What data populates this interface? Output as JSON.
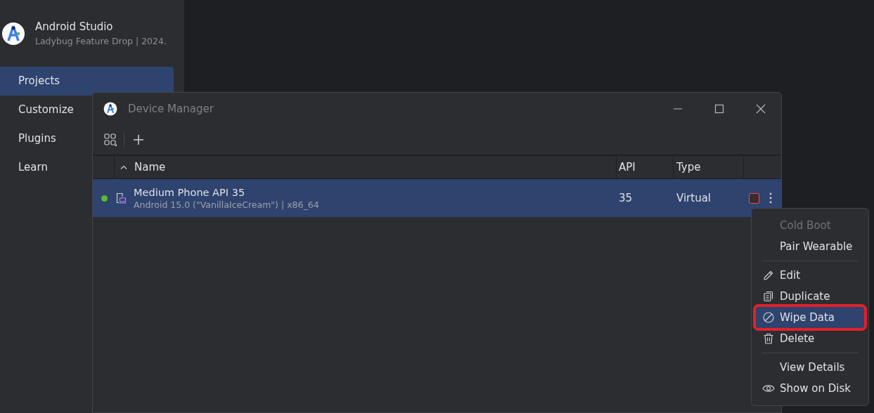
{
  "app": {
    "title": "Android Studio",
    "subtitle": "Ladybug Feature Drop | 2024."
  },
  "sidebar": {
    "items": [
      {
        "label": "Projects",
        "selected": true
      },
      {
        "label": "Customize",
        "selected": false
      },
      {
        "label": "Plugins",
        "selected": false
      },
      {
        "label": "Learn",
        "selected": false
      }
    ]
  },
  "dialog": {
    "title": "Device Manager",
    "table": {
      "columns": [
        {
          "label": "Name",
          "sorted": true
        },
        {
          "label": "API",
          "sorted": false
        },
        {
          "label": "Type",
          "sorted": false
        }
      ],
      "rows": [
        {
          "name": "Medium Phone API 35",
          "details": "Android 15.0 (\"VanillaIceCream\") | x86_64",
          "api": "35",
          "type": "Virtual",
          "selected": true,
          "color": "#5fb832",
          "running": true
        }
      ]
    }
  },
  "context_menu": {
    "items": [
      {
        "kind": "plain",
        "label": "Cold Boot",
        "disabled": true,
        "selected": false,
        "highlighted": false
      },
      {
        "kind": "plain",
        "label": "Pair Wearable",
        "disabled": false,
        "selected": false,
        "highlighted": false
      },
      {
        "kind": "separator"
      },
      {
        "kind": "pencil",
        "label": "Edit",
        "disabled": false,
        "selected": false,
        "highlighted": false
      },
      {
        "kind": "copy",
        "label": "Duplicate",
        "disabled": false,
        "selected": false,
        "highlighted": false
      },
      {
        "kind": "blocked",
        "label": "Wipe Data",
        "disabled": false,
        "selected": true,
        "highlighted": true
      },
      {
        "kind": "trash",
        "label": "Delete",
        "disabled": false,
        "selected": false,
        "highlighted": false
      },
      {
        "kind": "separator"
      },
      {
        "kind": "plain",
        "label": "View Details",
        "disabled": false,
        "selected": false,
        "highlighted": false
      },
      {
        "kind": "eye",
        "label": "Show on Disk",
        "disabled": false,
        "selected": false,
        "highlighted": false
      }
    ]
  }
}
